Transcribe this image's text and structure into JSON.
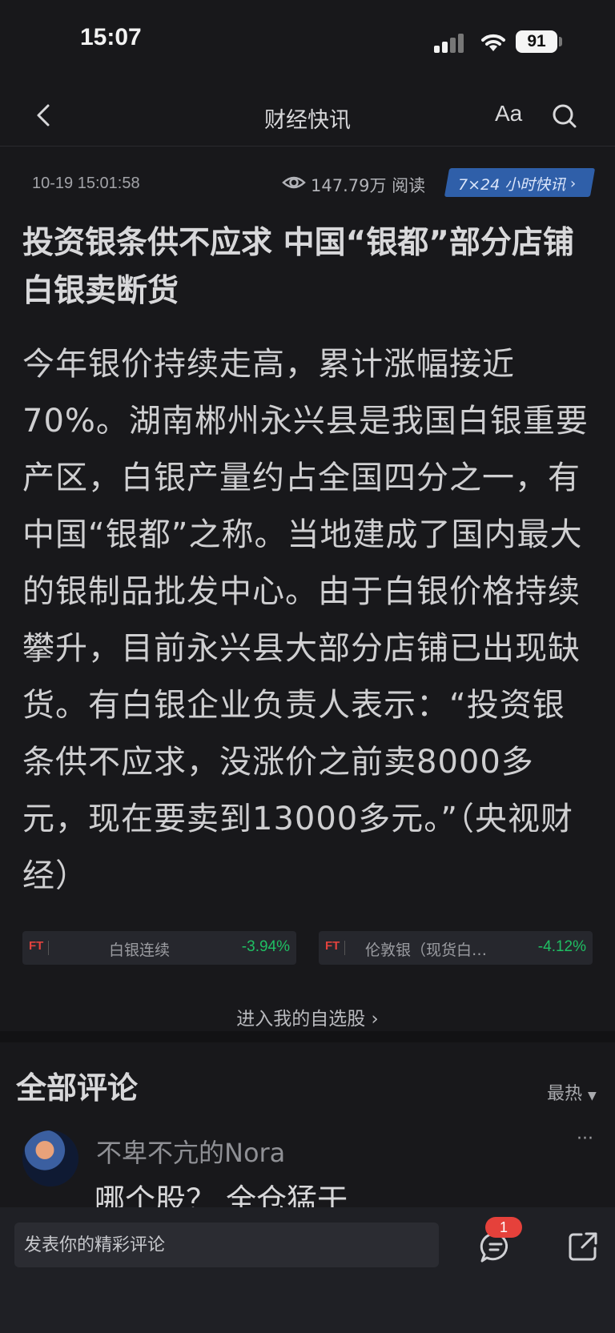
{
  "status_bar": {
    "time": "15:07",
    "battery": "91"
  },
  "nav": {
    "title": "财经快讯",
    "font_button": "Aa"
  },
  "article": {
    "datetime": "10-19 15:01:58",
    "views": "147.79万 阅读",
    "badge": "7×24 小时快讯",
    "title": "投资银条供不应求 中国“银都”部分店铺白银卖断货",
    "body": "今年银价持续走高，累计涨幅接近70%。湖南郴州永兴县是我国白银重要产区，白银产量约占全国四分之一，有中国“银都”之称。当地建成了国内最大的银制品批发中心。由于白银价格持续攀升，目前永兴县大部分店铺已出现缺货。有白银企业负责人表示：“投资银条供不应求，没涨价之前卖8000多元，现在要卖到13000多元。”（央视财经）"
  },
  "stocks": [
    {
      "tag": "FT",
      "name": "白银连续",
      "change": "-3.94%"
    },
    {
      "tag": "FT",
      "name": "伦敦银（现货白…",
      "change": "-4.12%"
    }
  ],
  "watchlist_link": "进入我的自选股",
  "comments": {
    "title": "全部评论",
    "sort": "最热",
    "items": [
      {
        "username": "不卑不亢的Nora",
        "text": "哪个股？ 全仓猛干"
      }
    ]
  },
  "bottom_bar": {
    "placeholder": "发表你的精彩评论",
    "badge_count": "1"
  },
  "colors": {
    "background": "#18181b",
    "badge_blue": "#2f5fa9",
    "negative_green": "#1fbf63",
    "notification_red": "#e5413b"
  }
}
